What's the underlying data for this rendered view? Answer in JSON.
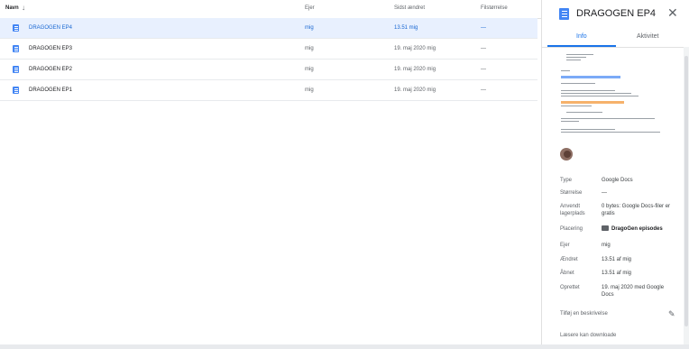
{
  "list": {
    "headers": {
      "name": "Navn",
      "owner": "Ejer",
      "modified": "Sidst ændret",
      "size": "Filstørrelse"
    },
    "rows": [
      {
        "name": "DRAGOGEN EP4",
        "owner": "mig",
        "modified": "13.51 mig",
        "size": "—"
      },
      {
        "name": "DRAGOGEN EP3",
        "owner": "mig",
        "modified": "19. maj 2020 mig",
        "size": "—"
      },
      {
        "name": "DRAGOGEN EP2",
        "owner": "mig",
        "modified": "19. maj 2020 mig",
        "size": "—"
      },
      {
        "name": "DRAGOGEN EP1",
        "owner": "mig",
        "modified": "19. maj 2020 mig",
        "size": "—"
      }
    ]
  },
  "panel": {
    "title": "DRAGOGEN EP4",
    "tabs": [
      "Info",
      "Aktivitet"
    ],
    "details": [
      {
        "label": "Type",
        "value": "Google Docs"
      },
      {
        "label": "Størrelse",
        "value": "—"
      },
      {
        "label": "Anvendt lagerplads",
        "value": "0 bytes: Google Docs-filer er gratis"
      },
      {
        "label": "Placering",
        "value": "DragoGen episodes"
      },
      {
        "label": "Ejer",
        "value": "mig"
      },
      {
        "label": "Ændret",
        "value": "13.51 af mig"
      },
      {
        "label": "Åbnet",
        "value": "13.51 af mig"
      },
      {
        "label": "Oprettet",
        "value": "19. maj 2020 med Google Docs"
      }
    ],
    "add_description": "Tilføj en beskrivelse",
    "readers_download": "Læsere kan downloade"
  },
  "icons": {
    "doc": "doc-icon",
    "close": "close-icon",
    "sort": "arrow-down-icon",
    "folder": "folder-icon",
    "edit": "pencil-icon"
  },
  "colors": {
    "accent": "#1a73e8",
    "doc": "#4285f4",
    "selected_row": "#e8f0fe"
  }
}
